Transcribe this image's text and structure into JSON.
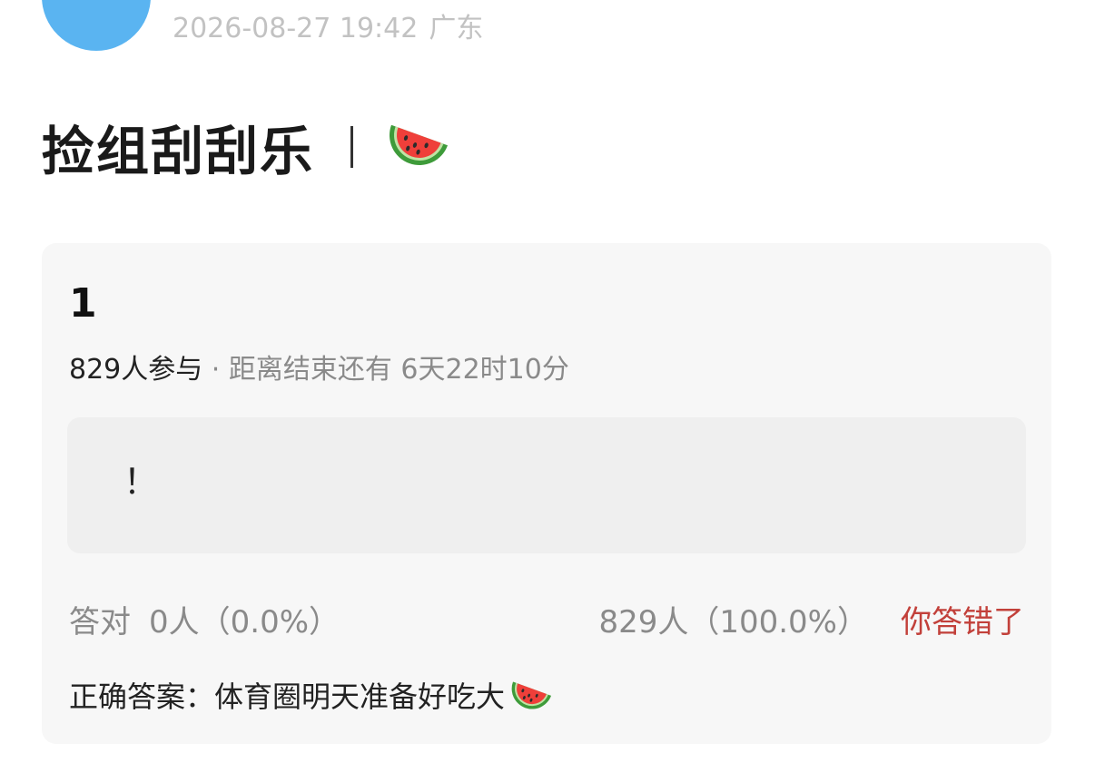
{
  "post": {
    "timestamp": "2026-08-27 19:42",
    "location": "广东"
  },
  "title": {
    "text": "捡组刮刮乐",
    "icon": "watermelon-icon"
  },
  "card": {
    "question_number": "1",
    "participants": "829人参与",
    "deadline": " · 距离结束还有 6天22时10分",
    "answer_text": "！",
    "correct_label": "答对",
    "correct_stats": "0人（0.0%）",
    "wrong_stats": "829人（100.0%）",
    "wrong_badge": "你答错了",
    "correct_answer": "正确答案：体育圈明天准备好吃大",
    "correct_answer_icon": "watermelon-icon"
  },
  "colors": {
    "avatar": "#5ab4f1",
    "card_bg": "#f7f7f7",
    "wrong_red": "#c2403a",
    "muted_gray": "#8a8a8a"
  }
}
